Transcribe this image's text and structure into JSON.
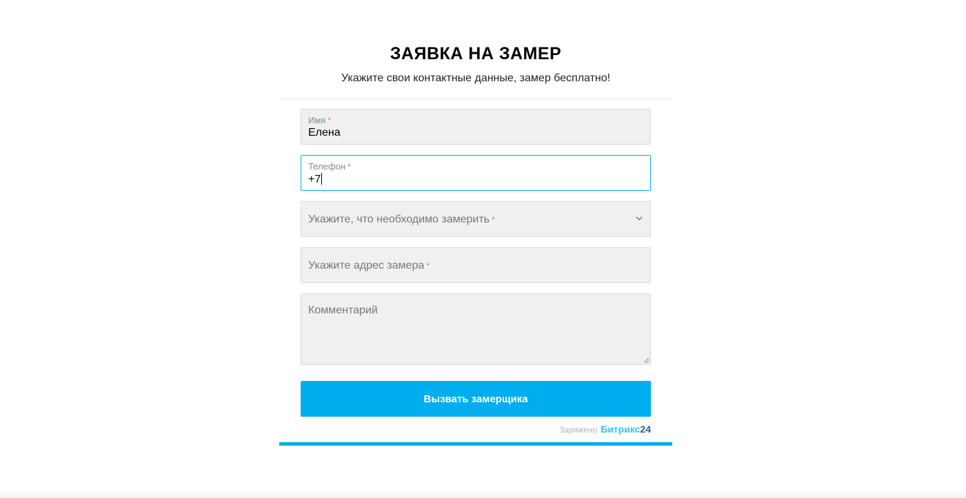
{
  "form": {
    "title": "ЗАЯВКА НА ЗАМЕР",
    "subtitle": "Укажите свои контактные данные, замер бесплатно!",
    "required_mark": "*",
    "fields": {
      "name": {
        "label": "Имя",
        "value": "Елена"
      },
      "phone": {
        "label": "Телефон",
        "value": "+7"
      },
      "measure_type": {
        "placeholder": "Укажите, что необходимо замерить"
      },
      "address": {
        "placeholder": "Укажите адрес замера"
      },
      "comment": {
        "placeholder": "Комментарий"
      }
    },
    "submit_label": "Вызвать замерщика"
  },
  "footer": {
    "powered_label": "Заряжено",
    "brand_name": "Битрикс",
    "brand_number": "24"
  },
  "colors": {
    "accent": "#00aef0",
    "field_background": "#f0f0f0",
    "active_border": "#00aaee",
    "required_mark": "#f26c6c"
  },
  "icons": {
    "select_arrow": "chevron-down-icon",
    "textarea_resize": "resize-grip-icon"
  }
}
